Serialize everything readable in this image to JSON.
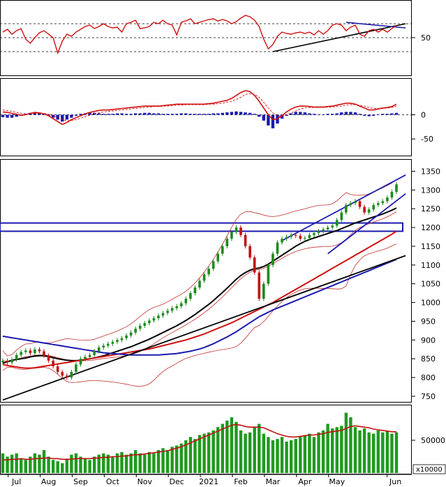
{
  "chart_data": [
    {
      "type": "line",
      "panel": "rsi",
      "title": "",
      "xlabel": "",
      "ylabel": "",
      "y_tick_labels": [
        "50"
      ],
      "reference_levels": [
        70,
        50,
        30
      ],
      "ylim": [
        0,
        100
      ],
      "grid": "dashed reference lines",
      "series": [
        {
          "color": "#d01010",
          "values": [
            58,
            62,
            55,
            60,
            63,
            48,
            42,
            50,
            57,
            60,
            55,
            50,
            28,
            45,
            55,
            52,
            58,
            62,
            66,
            68,
            63,
            66,
            70,
            66,
            64,
            65,
            58,
            70,
            72,
            75,
            63,
            64,
            66,
            72,
            70,
            75,
            70,
            68,
            54,
            72,
            74,
            77,
            70,
            72,
            74,
            76,
            77,
            74,
            76,
            74,
            70,
            73,
            78,
            82,
            80,
            75,
            66,
            48,
            34,
            40,
            52,
            58,
            56,
            55,
            57,
            58,
            56,
            58,
            54,
            60,
            55,
            60,
            68,
            70,
            68,
            60,
            65,
            68,
            55,
            52,
            60,
            62,
            58,
            62,
            58,
            63,
            68
          ]
        }
      ],
      "annotations": {
        "trendlines": [
          {
            "color": "#000000",
            "from_index": 59,
            "from_value": 30,
            "to_index": 88,
            "to_value": 70
          },
          {
            "color": "#1a1ab0",
            "from_index": 75,
            "from_value": 72,
            "to_index": 88,
            "to_value": 64
          }
        ]
      }
    },
    {
      "type": "bar",
      "panel": "macd",
      "title": "",
      "xlabel": "",
      "ylabel": "",
      "y_tick_labels": [
        "0",
        "-50"
      ],
      "ylim": [
        -80,
        70
      ],
      "histogram_color": "#1a1ab0",
      "histogram": [
        -5,
        -6,
        -6,
        -4,
        -2,
        2,
        4,
        5,
        4,
        2,
        -2,
        -6,
        -10,
        -14,
        -10,
        -6,
        -2,
        2,
        3,
        4,
        4,
        3,
        2,
        2,
        2,
        3,
        3,
        2,
        2,
        3,
        3,
        4,
        4,
        3,
        3,
        2,
        2,
        2,
        2,
        3,
        3,
        2,
        2,
        2,
        2,
        2,
        3,
        3,
        4,
        5,
        6,
        7,
        6,
        5,
        4,
        2,
        -4,
        -12,
        -22,
        -28,
        -18,
        -8,
        -2,
        3,
        6,
        6,
        5,
        3,
        2,
        1,
        1,
        2,
        2,
        3,
        5,
        6,
        6,
        5,
        2,
        -2,
        -3,
        -2,
        1,
        2,
        2,
        3,
        4
      ],
      "series": [
        {
          "name": "macd",
          "color": "#d01010",
          "values": [
            6,
            5,
            3,
            1,
            -1,
            0,
            3,
            5,
            4,
            2,
            -2,
            -8,
            -14,
            -20,
            -16,
            -10,
            -6,
            -2,
            2,
            5,
            7,
            9,
            10,
            10,
            11,
            12,
            13,
            14,
            15,
            16,
            17,
            18,
            18,
            18,
            18,
            19,
            20,
            21,
            22,
            22,
            22,
            22,
            22,
            22,
            22,
            23,
            24,
            26,
            28,
            30,
            34,
            40,
            46,
            50,
            48,
            40,
            28,
            14,
            0,
            -10,
            -8,
            -2,
            6,
            12,
            16,
            18,
            18,
            17,
            16,
            16,
            16,
            17,
            18,
            20,
            22,
            24,
            24,
            22,
            18,
            14,
            10,
            10,
            12,
            14,
            15,
            17,
            22
          ]
        },
        {
          "name": "signal",
          "color": "#d01010",
          "dashed": true,
          "values": [
            10,
            9,
            7,
            5,
            3,
            2,
            2,
            3,
            3,
            3,
            1,
            -2,
            -6,
            -10,
            -12,
            -12,
            -10,
            -7,
            -4,
            -1,
            2,
            4,
            6,
            7,
            8,
            9,
            10,
            11,
            12,
            13,
            14,
            15,
            16,
            17,
            17,
            18,
            18,
            19,
            20,
            20,
            21,
            21,
            21,
            21,
            21,
            22,
            22,
            23,
            24,
            26,
            28,
            32,
            36,
            42,
            44,
            42,
            36,
            26,
            14,
            4,
            -2,
            -3,
            0,
            4,
            8,
            12,
            14,
            15,
            15,
            15,
            15,
            16,
            16,
            17,
            18,
            20,
            21,
            21,
            20,
            18,
            15,
            13,
            13,
            13,
            14,
            15,
            18
          ]
        }
      ]
    },
    {
      "type": "candlestick",
      "panel": "price",
      "title": "",
      "xlabel": "",
      "ylabel": "",
      "ylim": [
        735,
        1375
      ],
      "y_tick_labels": [
        "1350",
        "1300",
        "1250",
        "1200",
        "1150",
        "1100",
        "1050",
        "1000",
        "950",
        "900",
        "850",
        "800",
        "750"
      ],
      "x_tick_labels": [
        "Jul",
        "Aug",
        "Sep",
        "Oct",
        "Nov",
        "Dec",
        "2021",
        "Feb",
        "Mar",
        "Apr",
        "May",
        "Jun"
      ],
      "close": [
        845,
        840,
        848,
        860,
        868,
        872,
        865,
        875,
        870,
        858,
        845,
        830,
        815,
        805,
        800,
        815,
        835,
        850,
        855,
        860,
        870,
        880,
        885,
        890,
        895,
        900,
        905,
        912,
        920,
        930,
        938,
        945,
        952,
        958,
        965,
        972,
        978,
        985,
        990,
        998,
        1010,
        1025,
        1040,
        1058,
        1075,
        1090,
        1110,
        1130,
        1150,
        1170,
        1188,
        1200,
        1180,
        1150,
        1120,
        1080,
        1010,
        1050,
        1100,
        1130,
        1160,
        1170,
        1175,
        1180,
        1178,
        1170,
        1172,
        1180,
        1185,
        1190,
        1195,
        1200,
        1205,
        1220,
        1240,
        1260,
        1265,
        1270,
        1255,
        1240,
        1248,
        1260,
        1265,
        1270,
        1280,
        1295,
        1315
      ],
      "bars": {
        "up_color": "#1d8a1d",
        "down_color": "#c01010"
      },
      "series": [
        {
          "name": "ma50",
          "color": "#000000",
          "values": [
            838,
            842,
            846,
            848,
            850,
            852,
            855,
            857,
            858,
            858,
            856,
            853,
            850,
            848,
            846,
            845,
            845,
            846,
            848,
            850,
            852,
            855,
            858,
            862,
            866,
            870,
            874,
            878,
            882,
            887,
            892,
            897,
            902,
            908,
            914,
            920,
            926,
            932,
            938,
            945,
            952,
            960,
            968,
            977,
            986,
            995,
            1005,
            1016,
            1027,
            1038,
            1050,
            1062,
            1072,
            1080,
            1086,
            1090,
            1092,
            1096,
            1102,
            1110,
            1118,
            1126,
            1134,
            1142,
            1150,
            1157,
            1163,
            1168,
            1172,
            1176,
            1180,
            1184,
            1188,
            1192,
            1197,
            1202,
            1207,
            1212,
            1216,
            1220,
            1224,
            1228,
            1232,
            1236,
            1241,
            1246,
            1252
          ]
        },
        {
          "name": "ma100",
          "color": "#d01010",
          "values": [
            835,
            832,
            830,
            828,
            826,
            825,
            825,
            826,
            828,
            830,
            832,
            834,
            836,
            838,
            840,
            842,
            844,
            846,
            848,
            850,
            852,
            854,
            856,
            858,
            860,
            862,
            864,
            866,
            868,
            870,
            872,
            874,
            876,
            879,
            882,
            885,
            888,
            891,
            894,
            897,
            900,
            904,
            908,
            912,
            916,
            921,
            926,
            931,
            936,
            941,
            946,
            952,
            958,
            964,
            970,
            976,
            982,
            988,
            994,
            1000,
            1007,
            1014,
            1021,
            1028,
            1035,
            1042,
            1049,
            1056,
            1063,
            1070,
            1077,
            1084,
            1091,
            1098,
            1105,
            1112,
            1119,
            1126,
            1133,
            1140,
            1147,
            1154,
            1161,
            1168,
            1175,
            1182,
            1190
          ]
        },
        {
          "name": "ma200",
          "color": "#1a1ab0",
          "values": [
            910,
            908,
            906,
            904,
            902,
            900,
            898,
            896,
            894,
            892,
            890,
            888,
            886,
            884,
            882,
            880,
            878,
            876,
            874,
            872,
            870,
            868,
            866,
            865,
            864,
            863,
            862,
            861,
            860,
            860,
            860,
            860,
            860,
            860,
            860,
            861,
            862,
            863,
            864,
            866,
            868,
            870,
            873,
            876,
            880,
            885,
            890,
            896,
            902,
            908,
            915,
            922,
            930,
            938,
            946,
            954,
            962,
            968,
            974,
            980,
            985,
            990,
            995,
            1000,
            1005,
            1010,
            1015,
            1020,
            1025,
            1030,
            1035,
            1040,
            1045,
            1050,
            1055,
            1060,
            1065,
            1070,
            1075,
            1080,
            1085,
            1090,
            1095,
            1100,
            1105,
            1110,
            1115
          ]
        }
      ],
      "bollinger_color": "#c03030",
      "annotations": {
        "resistance_box": {
          "color": "#1a1ab0",
          "from": 1190,
          "to": 1212
        },
        "trendlines": [
          {
            "color": "#000000",
            "from_index": 0,
            "from_value": 740,
            "to_index": 88,
            "to_value": 1125
          },
          {
            "color": "#1a1ab0",
            "from_index": 61,
            "from_value": 1165,
            "to_index": 88,
            "to_value": 1340
          },
          {
            "color": "#1a1ab0",
            "from_index": 71,
            "from_value": 1130,
            "to_index": 88,
            "to_value": 1290
          }
        ]
      }
    },
    {
      "type": "bar",
      "panel": "volume",
      "title": "",
      "xlabel": "",
      "ylabel": "",
      "y_tick_labels": [
        "50000"
      ],
      "unit_label": "x10000",
      "ylim": [
        0,
        100000
      ],
      "bar_color": "#1f9a1f",
      "values": [
        30000,
        25000,
        28000,
        30000,
        22000,
        20000,
        25000,
        30000,
        28000,
        35000,
        25000,
        20000,
        18000,
        15000,
        22000,
        28000,
        30000,
        25000,
        22000,
        20000,
        25000,
        28000,
        30000,
        28000,
        25000,
        30000,
        32000,
        28000,
        30000,
        35000,
        30000,
        28000,
        32000,
        30000,
        35000,
        38000,
        35000,
        40000,
        42000,
        45000,
        50000,
        55000,
        52000,
        58000,
        60000,
        62000,
        65000,
        70000,
        75000,
        80000,
        85000,
        78000,
        65000,
        60000,
        62000,
        70000,
        75000,
        60000,
        55000,
        50000,
        52000,
        55000,
        48000,
        50000,
        52000,
        55000,
        58000,
        60000,
        55000,
        62000,
        65000,
        75000,
        68000,
        70000,
        72000,
        92000,
        85000,
        70000,
        65000,
        68000,
        62000,
        60000,
        65000,
        62000,
        64000,
        60000,
        62000
      ],
      "series": [
        {
          "name": "volume-ma",
          "color": "#c01010",
          "values": [
            20000,
            20000,
            21000,
            21000,
            22000,
            21000,
            21000,
            22000,
            22000,
            23000,
            23000,
            22000,
            22000,
            21000,
            21000,
            21000,
            22000,
            22000,
            22000,
            22000,
            23000,
            23000,
            24000,
            24000,
            25000,
            25000,
            26000,
            26000,
            27000,
            28000,
            28000,
            29000,
            30000,
            31000,
            32000,
            33000,
            34000,
            36000,
            38000,
            40000,
            43000,
            46000,
            49000,
            52000,
            55000,
            58000,
            61000,
            64000,
            67000,
            70000,
            73000,
            74000,
            73000,
            71000,
            70000,
            70000,
            70000,
            69000,
            66000,
            63000,
            60000,
            58000,
            56000,
            55000,
            55000,
            56000,
            57000,
            58000,
            58000,
            59000,
            60000,
            62000,
            63000,
            64000,
            65000,
            68000,
            71000,
            72000,
            71000,
            70000,
            69000,
            67000,
            66000,
            65000,
            64000,
            63000,
            63000
          ]
        }
      ]
    }
  ]
}
